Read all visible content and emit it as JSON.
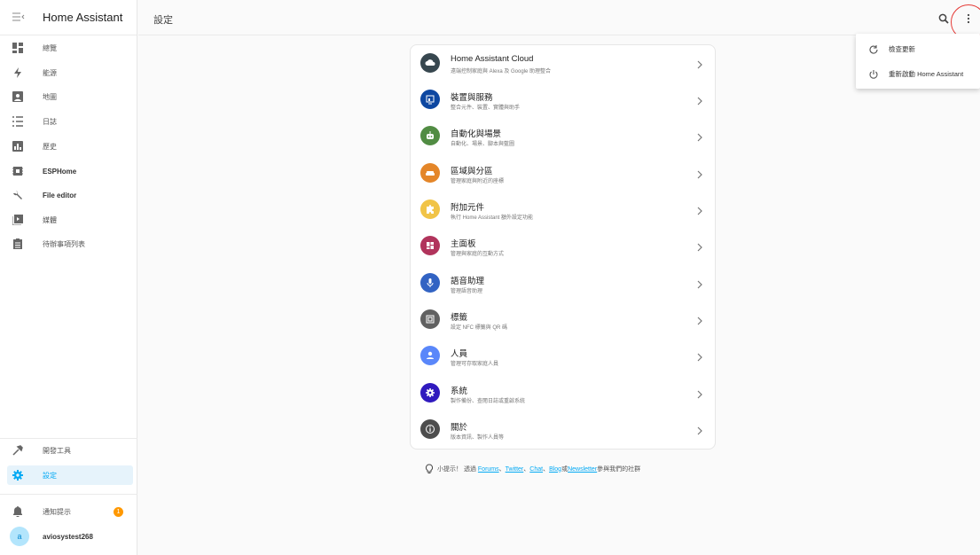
{
  "app": {
    "title": "Home Assistant"
  },
  "page": {
    "title": "設定"
  },
  "sidebar": {
    "items": [
      {
        "label": "總覽",
        "icon": "dashboard-icon"
      },
      {
        "label": "能源",
        "icon": "lightning-icon"
      },
      {
        "label": "地圖",
        "icon": "map-account-icon"
      },
      {
        "label": "日誌",
        "icon": "logbook-list-icon"
      },
      {
        "label": "歷史",
        "icon": "history-chart-icon"
      },
      {
        "label": "ESPHome",
        "icon": "esphome-icon"
      },
      {
        "label": "File editor",
        "icon": "wrench-icon"
      },
      {
        "label": "媒體",
        "icon": "media-play-icon"
      },
      {
        "label": "待辦事項列表",
        "icon": "clipboard-list-icon"
      }
    ],
    "bottom": {
      "dev_tools": "開發工具",
      "settings": "設定",
      "notifications": "通知提示",
      "notification_count": "1",
      "user_initial": "a",
      "user_name": "aviosystest268"
    }
  },
  "menu": {
    "items": [
      {
        "label": "檢查更新",
        "icon": "refresh-icon"
      },
      {
        "label": "重新啟動 Home Assistant",
        "icon": "power-icon"
      }
    ]
  },
  "settings": {
    "rows": [
      {
        "title": "Home Assistant Cloud",
        "subtitle": "遠端控制家庭與 Alexa 及 Google 助理整合",
        "icon": "cloud-icon",
        "color": "#37474f"
      },
      {
        "title": "裝置與服務",
        "subtitle": "整合元件、裝置、實體與助手",
        "icon": "devices-icon",
        "color": "#0d47a1"
      },
      {
        "title": "自動化與場景",
        "subtitle": "自動化、場景、腳本與藍圖",
        "icon": "robot-icon",
        "color": "#518c43"
      },
      {
        "title": "區域與分區",
        "subtitle": "管理家庭與附近的座標",
        "icon": "sofa-icon",
        "color": "#e48629"
      },
      {
        "title": "附加元件",
        "subtitle": "執行 Home Assistant 額外設定功能",
        "icon": "puzzle-icon",
        "color": "#f1c447"
      },
      {
        "title": "主面板",
        "subtitle": "管理與家庭的互動方式",
        "icon": "view-dashboard-icon",
        "color": "#b1345c"
      },
      {
        "title": "語音助理",
        "subtitle": "管理語音助理",
        "icon": "microphone-icon",
        "color": "#3263c3"
      },
      {
        "title": "標籤",
        "subtitle": "設定 NFC 標籤與 QR 碼",
        "icon": "nfc-tag-icon",
        "color": "#616161"
      },
      {
        "title": "人員",
        "subtitle": "管理可存取家庭人員",
        "icon": "account-icon",
        "color": "#5a87fa"
      },
      {
        "title": "系統",
        "subtitle": "製作備份、查閱日誌或重啟系統",
        "icon": "cog-icon",
        "color": "#301ABE"
      },
      {
        "title": "關於",
        "subtitle": "版本資訊、製作人員等",
        "icon": "info-icon",
        "color": "#4d4d4d"
      }
    ]
  },
  "tip": {
    "prefix": "小提示！ 透過",
    "forums": "Forums",
    "sep1": "、",
    "twitter": "Twitter",
    "sep2": "、",
    "chat": "Chat",
    "sep3": "、",
    "blog": "Blog",
    "or": " 或 ",
    "newsletter": "Newsletter",
    "suffix": " 參與我們的社群"
  },
  "colors": {
    "accent": "#03a9f4",
    "badge": "#ff9800",
    "highlight_circle": "#e53935"
  }
}
